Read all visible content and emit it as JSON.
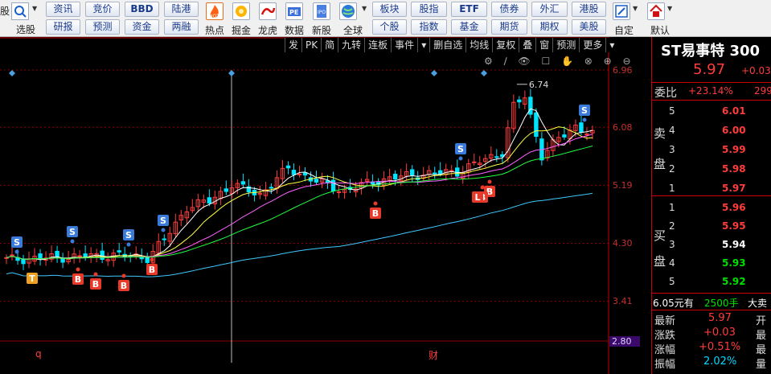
{
  "toolbar": {
    "row1_buttons": [
      "资讯",
      "竞价",
      "BBD",
      "陆港"
    ],
    "row2_buttons": [
      "研报",
      "预测",
      "资金",
      "两融"
    ],
    "row1_buttons_b": [
      "板块",
      "股指",
      "ETF",
      "债券",
      "外汇",
      "港股"
    ],
    "row2_buttons_b": [
      "个股",
      "指数",
      "基金",
      "期货",
      "期权",
      "美股"
    ],
    "left_labels": [
      "股",
      "选股"
    ],
    "icon_labels": [
      "热点",
      "掘金",
      "龙虎",
      "数据",
      "新股",
      "全球"
    ],
    "right_labels": [
      "自定",
      "默认"
    ],
    "icon_names": [
      "hot-icon",
      "gold-icon",
      "dragon-icon",
      "pe-data-icon",
      "ipo-icon",
      "globe-icon"
    ]
  },
  "chart_tabs": [
    "发",
    "PK",
    "简",
    "九转",
    "连板",
    "事件",
    "▾",
    "删自选",
    "均线",
    "复权",
    "叠",
    "窗",
    "预测",
    "更多",
    "▾"
  ],
  "chart_icons": "⚙ ∕ 👁 ☐ ✋ ⊗ ⊕ ⊖",
  "axis": {
    "labels": [
      "6.96",
      "6.08",
      "5.19",
      "4.30",
      "3.41",
      "2.80"
    ],
    "bottom_markers": [
      "q",
      "财"
    ]
  },
  "annotation": {
    "max_label": "6.74"
  },
  "signals": {
    "buy": "B",
    "sell": "S",
    "t": "T",
    "loan": "L"
  },
  "quote": {
    "name": "ST易事特 300",
    "price": "5.97",
    "change": "+0.03",
    "weibi_label": "委比",
    "weibi_value": "+23.14%",
    "weicha_value": "299",
    "sell_side_label": [
      "卖",
      "盘"
    ],
    "buy_side_label": [
      "买",
      "盘"
    ],
    "asks": [
      {
        "level": "5",
        "price": "6.01"
      },
      {
        "level": "4",
        "price": "6.00"
      },
      {
        "level": "3",
        "price": "5.99"
      },
      {
        "level": "2",
        "price": "5.98"
      },
      {
        "level": "1",
        "price": "5.97"
      }
    ],
    "bids": [
      {
        "level": "1",
        "price": "5.96"
      },
      {
        "level": "2",
        "price": "5.95"
      },
      {
        "level": "3",
        "price": "5.94"
      },
      {
        "level": "4",
        "price": "5.93"
      },
      {
        "level": "5",
        "price": "5.92"
      }
    ],
    "big_order": {
      "price": "6.05元有",
      "qty": "2500手",
      "tail": "大卖"
    },
    "stats": [
      {
        "label": "最新",
        "value": "5.97",
        "tail": "开"
      },
      {
        "label": "涨跌",
        "value": "+0.03",
        "tail": "最"
      },
      {
        "label": "涨幅",
        "value": "+0.51%",
        "tail": "最"
      },
      {
        "label": "振幅",
        "value": "2.02%",
        "tail": "量"
      }
    ]
  },
  "colors": {
    "up": "#ff3c3c",
    "down": "#00e5ff",
    "green": "#00d000",
    "grid": "#8b0000"
  }
}
